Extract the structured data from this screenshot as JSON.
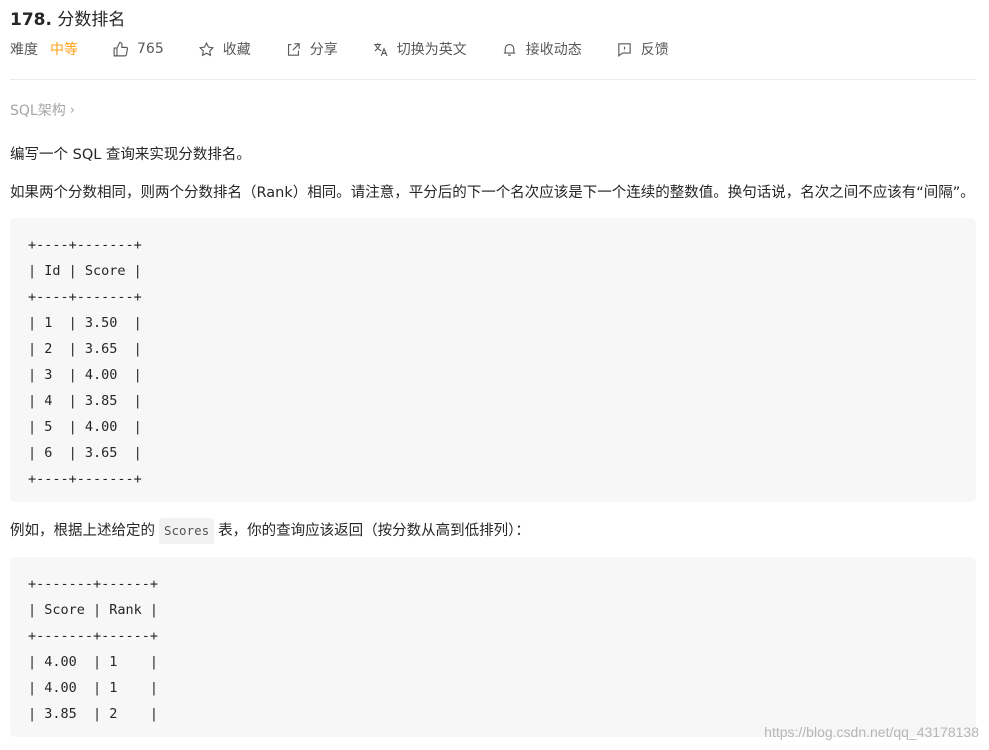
{
  "problem": {
    "number": "178.",
    "title": "分数排名"
  },
  "meta": {
    "difficulty_label": "难度",
    "difficulty_value": "中等",
    "likes": "765",
    "favorite_label": "收藏",
    "share_label": "分享",
    "switch_lang_label": "切换为英文",
    "subscribe_label": "接收动态",
    "feedback_label": "反馈"
  },
  "breadcrumb": {
    "label": "SQL架构",
    "chevron": "›"
  },
  "description": {
    "p1": "编写一个 SQL 查询来实现分数排名。",
    "p2": "如果两个分数相同，则两个分数排名（Rank）相同。请注意，平分后的下一个名次应该是下一个连续的整数值。换句话说，名次之间不应该有“间隔”。",
    "scores_table": "+----+-------+\n| Id | Score |\n+----+-------+\n| 1  | 3.50  |\n| 2  | 3.65  |\n| 3  | 4.00  |\n| 4  | 3.85  |\n| 5  | 4.00  |\n| 6  | 3.65  |\n+----+-------+",
    "p3_before": "例如，根据上述给定的",
    "p3_code": "Scores",
    "p3_after": "表，你的查询应该返回（按分数从高到低排列）：",
    "result_table": "+-------+------+\n| Score | Rank |\n+-------+------+\n| 4.00  | 1    |\n| 4.00  | 1    |\n| 3.85  | 2    |"
  },
  "watermark": "https://blog.csdn.net/qq_43178138"
}
